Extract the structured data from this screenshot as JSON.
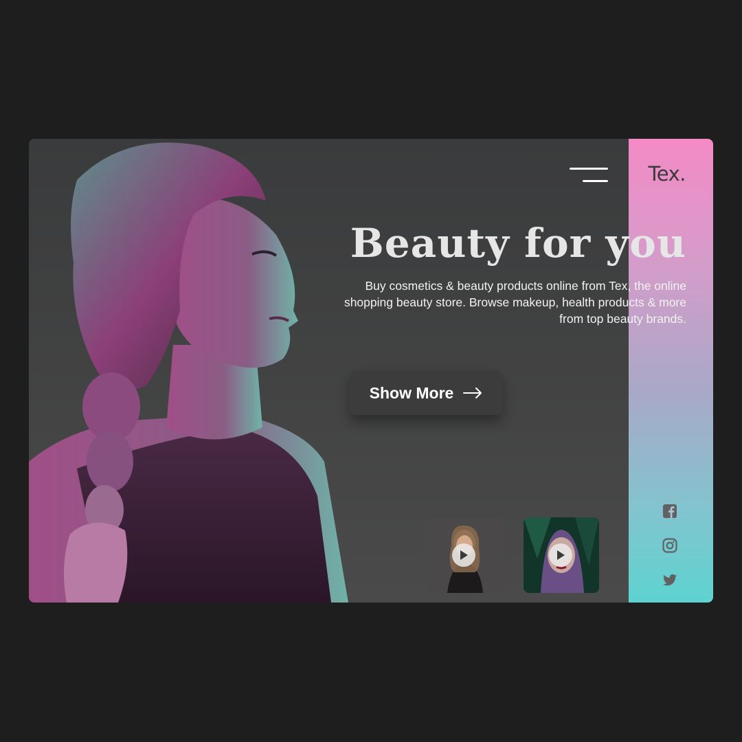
{
  "brand": {
    "logo": "Tex."
  },
  "hero": {
    "headline": "Beauty for you",
    "description": "Buy cosmetics & beauty products online from Tex, the online shopping beauty store. Browse makeup, health products & more from top beauty brands.",
    "cta_label": "Show More"
  },
  "thumbnails": [
    {
      "icon": "play-icon"
    },
    {
      "icon": "play-icon"
    }
  ],
  "social": [
    "facebook-icon",
    "instagram-icon",
    "twitter-icon"
  ],
  "colors": {
    "background": "#1e1e1e",
    "card": "#3a3b3c",
    "accent_top": "#f48ac6",
    "accent_bottom": "#5dd3cf"
  }
}
